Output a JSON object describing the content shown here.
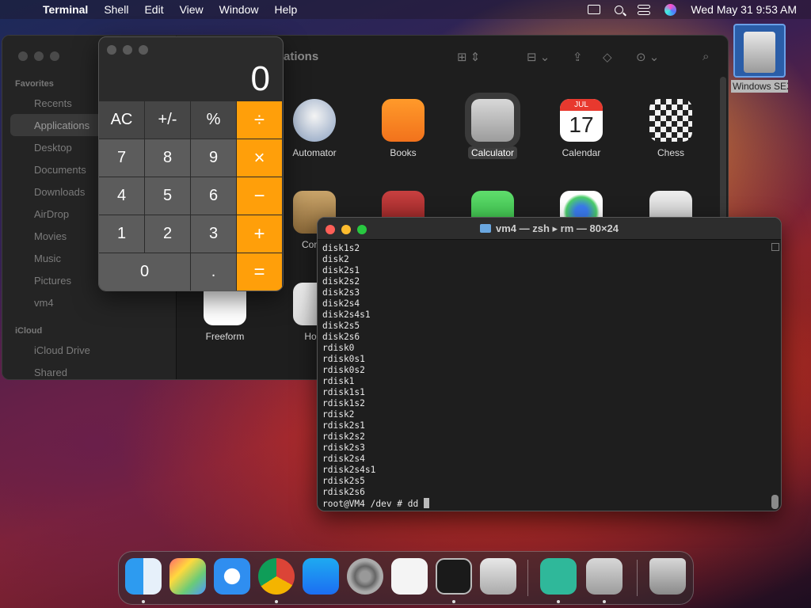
{
  "menubar": {
    "app": "Terminal",
    "items": [
      "Shell",
      "Edit",
      "View",
      "Window",
      "Help"
    ],
    "clock": "Wed May 31  9:53 AM"
  },
  "finder": {
    "title_fragment": "ations",
    "sidebar": {
      "favorites_header": "Favorites",
      "favorites": [
        "Recents",
        "Applications",
        "Desktop",
        "Documents",
        "Downloads",
        "AirDrop",
        "Movies",
        "Music",
        "Pictures",
        "vm4"
      ],
      "icloud_header": "iCloud",
      "icloud": [
        "iCloud Drive",
        "Shared"
      ]
    },
    "apps": [
      "Automator",
      "Books",
      "Calculator",
      "Calendar",
      "Chess",
      "Conta",
      "Freeform",
      "Hom"
    ],
    "calendar_month": "JUL",
    "calendar_day": "17"
  },
  "calculator": {
    "display": "0",
    "keys": [
      "AC",
      "+/-",
      "%",
      "÷",
      "7",
      "8",
      "9",
      "×",
      "4",
      "5",
      "6",
      "−",
      "1",
      "2",
      "3",
      "+",
      "0",
      ".",
      "="
    ]
  },
  "terminal": {
    "title": "vm4 — zsh ▸ rm — 80×24",
    "lines": [
      "disk1s2",
      "disk2",
      "disk2s1",
      "disk2s2",
      "disk2s3",
      "disk2s4",
      "disk2s4s1",
      "disk2s5",
      "disk2s6",
      "rdisk0",
      "rdisk0s1",
      "rdisk0s2",
      "rdisk1",
      "rdisk1s1",
      "rdisk1s2",
      "rdisk2",
      "rdisk2s1",
      "rdisk2s2",
      "rdisk2s3",
      "rdisk2s4",
      "rdisk2s4s1",
      "rdisk2s5",
      "rdisk2s6"
    ],
    "prompt": "root@VM4 /dev # dd "
  },
  "desktop_icon": {
    "label": "Windows SEX"
  },
  "dock": {
    "apps": [
      "finder-icon",
      "launchpad-icon",
      "safari-icon",
      "chrome-icon",
      "app-store-icon",
      "system-settings-icon",
      "textedit-icon",
      "terminal-icon",
      "utm-icon",
      "remote-app-icon",
      "calculator-icon",
      "trash-icon"
    ]
  }
}
